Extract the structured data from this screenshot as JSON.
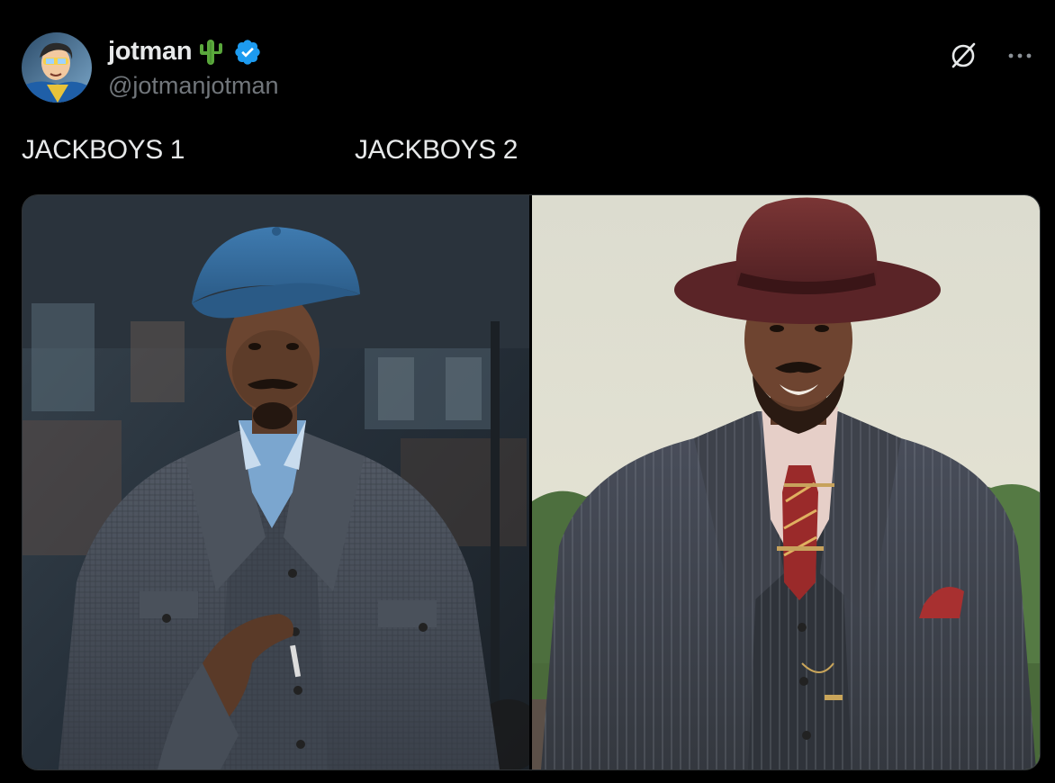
{
  "author": {
    "display_name": "jotman",
    "name_emoji": "cactus",
    "verified": true,
    "handle": "@jotmanjotman",
    "avatar": "avatar-cartoon-icon"
  },
  "actions": {
    "grok_icon": "grok-icon",
    "more_icon": "more-icon"
  },
  "text": {
    "part1": "JACKBOYS 1",
    "part2": "JACKBOYS 2"
  },
  "media": {
    "left_image": "man-in-blue-flat-cap-tweed-suit",
    "right_image": "man-in-burgundy-fedora-pinstripe-suit"
  },
  "colors": {
    "background": "#000000",
    "text": "#e7e9ea",
    "secondary_text": "#71767b",
    "verified_blue": "#1d9bf0"
  }
}
